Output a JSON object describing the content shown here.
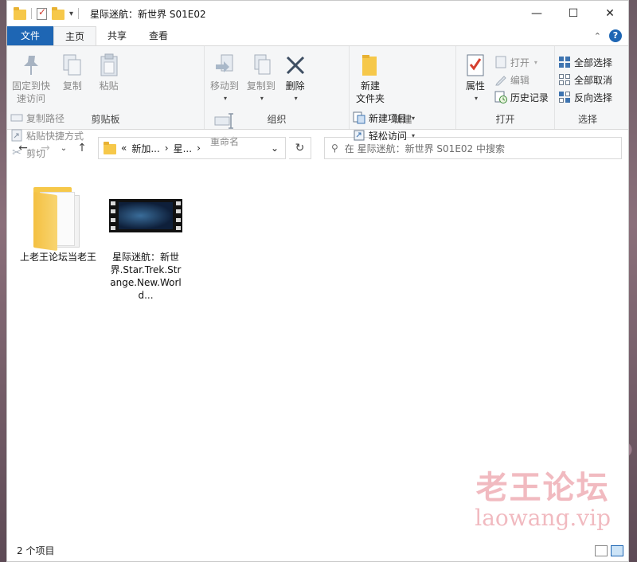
{
  "window": {
    "title": "星际迷航：新世界 S01E02",
    "controls": {
      "minimize": "—",
      "maximize": "☐",
      "close": "✕"
    }
  },
  "tabs": [
    {
      "label": "文件"
    },
    {
      "label": "主页"
    },
    {
      "label": "共享"
    },
    {
      "label": "查看"
    }
  ],
  "ribbon": {
    "clipboard": {
      "group_label": "剪贴板",
      "pin_label": "固定到快\n速访问",
      "copy_label": "复制",
      "paste_label": "粘贴",
      "copy_path": "复制路径",
      "paste_shortcut": "粘贴快捷方式",
      "cut": "剪切"
    },
    "organize": {
      "group_label": "组织",
      "move_to": "移动到",
      "copy_to": "复制到",
      "delete": "删除",
      "rename": "重命名"
    },
    "new": {
      "group_label": "新建",
      "new_folder": "新建\n文件夹",
      "new_item": "新建项目",
      "easy_access": "轻松访问"
    },
    "open": {
      "group_label": "打开",
      "properties": "属性",
      "open": "打开",
      "edit": "编辑",
      "history": "历史记录"
    },
    "select": {
      "group_label": "选择",
      "select_all": "全部选择",
      "select_none": "全部取消",
      "invert": "反向选择"
    }
  },
  "navbar": {
    "breadcrumb_overflow": "«",
    "crumb1": "新加...",
    "crumb2": "星...",
    "search_placeholder": "在 星际迷航：新世界 S01E02 中搜索"
  },
  "items": [
    {
      "label": "上老王论坛当老王",
      "kind": "folder"
    },
    {
      "label": "星际迷航：新世界.Star.Trek.Strange.New.World...",
      "kind": "video"
    }
  ],
  "status": {
    "count": "2 个项目"
  },
  "watermark": {
    "cn": "老王论坛",
    "en": "laowang.vip"
  },
  "colors": {
    "accent": "#1e66b4",
    "folder": "#f6c84a"
  }
}
